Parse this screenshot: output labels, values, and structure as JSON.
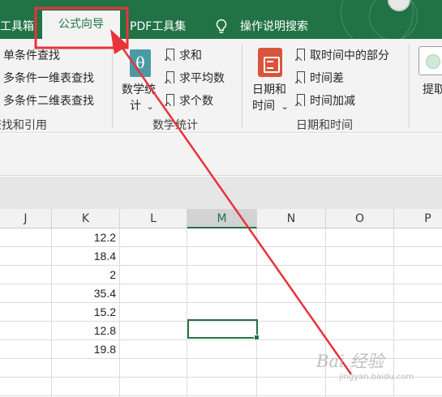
{
  "tabs": {
    "toolbox": "工具箱",
    "formula_guide": "公式向导",
    "pdf_tools": "PDF工具集",
    "search": "操作说明搜索"
  },
  "ribbon": {
    "lookup": {
      "items": [
        "单条件查找",
        "多条件一维表查找",
        "多条件二维表查找"
      ],
      "group_label": "查找和引用"
    },
    "math": {
      "big_button_line1": "数学统",
      "big_button_line2": "计",
      "icon_glyph": "θ",
      "items": [
        "求和",
        "求平均数",
        "求个数"
      ],
      "group_label": "数学统计"
    },
    "datetime": {
      "big_button_line1": "日期和",
      "big_button_line2": "时间",
      "items": [
        "取时间中的部分",
        "时间差",
        "时间加减"
      ],
      "group_label": "日期和时间"
    },
    "extract": {
      "label": "提取"
    },
    "dropdown_glyph": "⌄"
  },
  "sheet": {
    "columns": [
      "J",
      "K",
      "L",
      "M",
      "N",
      "O",
      "P"
    ],
    "active_column": "M",
    "column_k_values": [
      "12.2",
      "18.4",
      "2",
      "35.4",
      "15.2",
      "12.8",
      "19.8"
    ]
  },
  "watermark": {
    "logo": "Bai 经验",
    "url": "jingyan.baidu.com"
  },
  "colors": {
    "excel_green": "#217346",
    "annotation_red": "#e8333a"
  }
}
